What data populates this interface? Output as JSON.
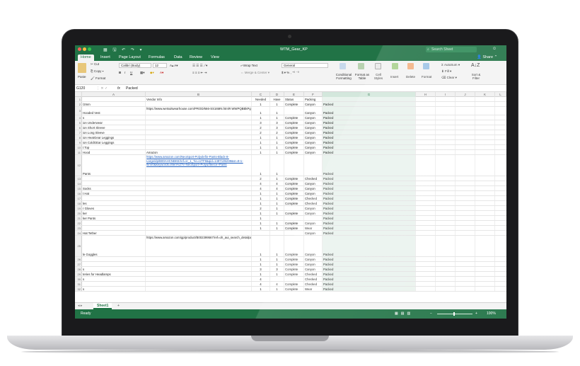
{
  "app": {
    "doc_title": "WTM_Gear_KP",
    "search_placeholder": "Search Sheet",
    "share_label": "Share",
    "colors": {
      "excel_green": "#217346",
      "link_blue": "#1f5fbf"
    }
  },
  "tabs": [
    "Home",
    "Insert",
    "Page Layout",
    "Formulas",
    "Data",
    "Review",
    "View"
  ],
  "ribbon": {
    "paste": "Paste",
    "cut": "Cut",
    "copy": "Copy",
    "format": "Format",
    "font_name": "Calibri (Body)",
    "font_size": "12",
    "wrap_text": "Wrap Text",
    "merge_center": "Merge & Center",
    "number_format": "General",
    "conditional_formatting": "Conditional Formatting",
    "format_as_table": "Format as Table",
    "cell_styles": "Cell Styles",
    "insert": "Insert",
    "delete": "Delete",
    "format_cells": "Format",
    "autosum": "AutoSum",
    "fill": "Fill",
    "clear": "Clear",
    "sort_filter": "Sort & Filter"
  },
  "formula_bar": {
    "cell_ref": "G120",
    "fx": "fx",
    "value": "Packed"
  },
  "columns": [
    "A",
    "B",
    "C",
    "D",
    "E",
    "F",
    "G",
    "H",
    "I",
    "J",
    "K",
    "L"
  ],
  "rows": [
    {
      "n": "1",
      "a": "",
      "b": "Vendor Info",
      "c": "Needed",
      "d": "Have",
      "e": "Status",
      "f": "Packing",
      "g": ""
    },
    {
      "n": "2",
      "a": "/2mm",
      "b": "",
      "c": "1",
      "d": "1",
      "e": "Complete",
      "f": "Canyon",
      "g": "Packed"
    },
    {
      "n": "3",
      "a": "Hooded Vest",
      "b": "https://www.wetsuitwearhouse.com/PROD/666-SS16MN.html#.WWPQBBkPg",
      "c": "1",
      "d": "1",
      "e": "",
      "f": "Canyon",
      "g": "Packed"
    },
    {
      "n": "4",
      "a": "s",
      "b": "",
      "c": "1",
      "d": "1",
      "e": "Complete",
      "f": "Canyon",
      "g": "Packed"
    },
    {
      "n": "5",
      "a": "ion Underwear",
      "b": "",
      "c": "3",
      "d": "3",
      "e": "Complete",
      "f": "Canyon",
      "g": "Packed"
    },
    {
      "n": "6",
      "a": "ion Short Sleeve",
      "b": "",
      "c": "2",
      "d": "3",
      "e": "Complete",
      "f": "Canyon",
      "g": "Packed"
    },
    {
      "n": "7",
      "a": "ion Long Sleeve",
      "b": "",
      "c": "2",
      "d": "2",
      "e": "Complete",
      "f": "Canyon",
      "g": "Packed"
    },
    {
      "n": "8",
      "a": "ion HeatGear Leggings",
      "b": "",
      "c": "1",
      "d": "1",
      "e": "Complete",
      "f": "Canyon",
      "g": "Packed"
    },
    {
      "n": "9",
      "a": "ion ColdGEar Leggings",
      "b": "",
      "c": "1",
      "d": "1",
      "e": "Complete",
      "f": "Canyon",
      "g": "Packed"
    },
    {
      "n": "10",
      "a": "t Top",
      "b": "",
      "c": "1",
      "d": "1",
      "e": "Complete",
      "f": "Canyon",
      "g": "Packed"
    },
    {
      "n": "11",
      "a": "Hood",
      "b": "Amazon",
      "c": "1",
      "d": "1",
      "e": "Complete",
      "f": "Canyon",
      "g": "Packed"
    },
    {
      "n": "12",
      "a": "Pants",
      "b": "https://www.amazon.com/NeoSport-Polyolefin-Pants-Black-8-Large/dp/B00AHCNBKE/ref=sr_1_?ie=UTF8&qid=1497135238&sr=8-1-fkmr0&keywords=Men%27s+NeoSport+Polyurfleece+Pants",
      "c": "1",
      "d": "1",
      "e": "",
      "f": "",
      "g": "Packed"
    },
    {
      "n": "13",
      "a": "",
      "b": "",
      "c": "2",
      "d": "1",
      "e": "Complete",
      "f": "Checked",
      "g": "Packed"
    },
    {
      "n": "14",
      "a": "",
      "b": "",
      "c": "4",
      "d": "4",
      "e": "Complete",
      "f": "Canyon",
      "g": "Packed"
    },
    {
      "n": "15",
      "a": "Socks",
      "b": "",
      "c": "4",
      "d": "4",
      "e": "Complete",
      "f": "Canyon",
      "g": "Packed"
    },
    {
      "n": "16",
      "a": "t Hat",
      "b": "",
      "c": "1",
      "d": "1",
      "e": "Complete",
      "f": "Canyon",
      "g": "Packed"
    },
    {
      "n": "17",
      "a": "",
      "b": "",
      "c": "1",
      "d": "1",
      "e": "Complete",
      "f": "Checked",
      "g": "Packed"
    },
    {
      "n": "18",
      "a": "les",
      "b": "",
      "c": "1",
      "d": "1",
      "e": "Complete",
      "f": "Checked",
      "g": "Packed"
    },
    {
      "n": "19",
      "a": "r Gloves",
      "b": "",
      "c": "2",
      "d": "1",
      "e": "",
      "f": "Canyon",
      "g": "Packed"
    },
    {
      "n": "20",
      "a": "ker",
      "b": "",
      "c": "1",
      "d": "1",
      "e": "Complete",
      "f": "Canyon",
      "g": "Packed"
    },
    {
      "n": "21",
      "a": "ker Pants",
      "b": "",
      "c": "1",
      "d": "",
      "e": "",
      "f": "",
      "g": "Packed"
    },
    {
      "n": "22",
      "a": "",
      "b": "",
      "c": "1",
      "d": "1",
      "e": "Complete",
      "f": "Canyon",
      "g": "Packed"
    },
    {
      "n": "23",
      "a": "",
      "b": "",
      "c": "1",
      "d": "1",
      "e": "Complete",
      "f": "Wear",
      "g": "Packed"
    },
    {
      "n": "24",
      "a": "Hat Tether",
      "b": "",
      "c": "",
      "d": "",
      "e": "",
      "f": "Canyon",
      "g": "Packed"
    },
    {
      "n": "25",
      "a": "le Goggles",
      "b": "https://www.amazon.com/gp/product/B002399567/ref=oh_aui_search_detailpage&linkCode=ogi&th=1&psc=1&redirect=true&ref_=oh_aui_search_detailpage&linkCode=d1&linkId=6e571e0b52a7a8974b552#b591469d",
      "c": "1",
      "d": "1",
      "e": "Complete",
      "f": "Canyon",
      "g": "Packed"
    },
    {
      "n": "26",
      "a": "",
      "b": "",
      "c": "1",
      "d": "1",
      "e": "Complete",
      "f": "Canyon",
      "g": "Packed"
    },
    {
      "n": "27",
      "a": "",
      "b": "",
      "c": "1",
      "d": "1",
      "e": "Complete",
      "f": "Canyon",
      "g": "Packed"
    },
    {
      "n": "28",
      "a": "s",
      "b": "",
      "c": "3",
      "d": "3",
      "e": "Complete",
      "f": "Canyon",
      "g": "Packed"
    },
    {
      "n": "29",
      "a": "teries for Headlamps",
      "b": "",
      "c": "1",
      "d": "1",
      "e": "Complete",
      "f": "Checked",
      "g": "Packed"
    },
    {
      "n": "30",
      "a": "s",
      "b": "",
      "c": "4",
      "d": "",
      "e": "",
      "f": "Checked",
      "g": "Packed"
    },
    {
      "n": "31",
      "a": "",
      "b": "",
      "c": "4",
      "d": "4",
      "e": "Complete",
      "f": "Checked",
      "g": "Packed"
    },
    {
      "n": "32",
      "a": "s",
      "b": "",
      "c": "1",
      "d": "1",
      "e": "Complete",
      "f": "Wear",
      "g": "Packed"
    }
  ],
  "sheet_tabs": [
    "Sheet1"
  ],
  "status": {
    "ready": "Ready",
    "zoom": "100%"
  }
}
